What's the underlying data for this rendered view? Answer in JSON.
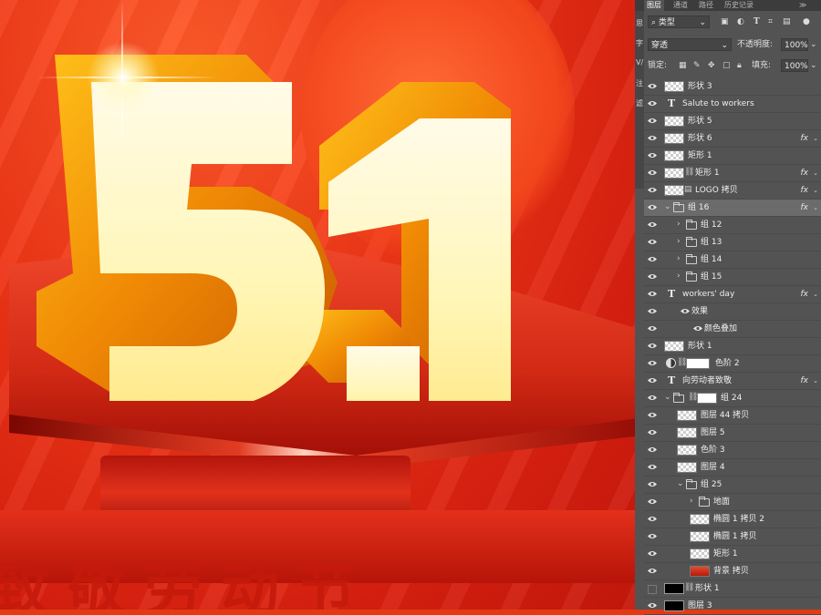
{
  "canvas": {
    "headline": "5.1",
    "floor_text": "致敬劳动节"
  },
  "panel": {
    "tabs": [
      "图层",
      "通道",
      "路径",
      "历史记录"
    ],
    "side_labels": [
      "思",
      "字",
      "V/",
      "注",
      "滤"
    ],
    "filter": {
      "kind_label": "类型",
      "icons": [
        "pixel-filter-icon",
        "adjustment-filter-icon",
        "text-filter-icon",
        "shape-filter-icon",
        "smart-object-filter-icon"
      ]
    },
    "blend_mode": "穿透",
    "opacity_label": "不透明度:",
    "opacity_value": "100%",
    "lock_label": "锁定:",
    "fill_label": "填充:",
    "fill_value": "100%",
    "layers": [
      {
        "name": "形状 3",
        "type": "shape",
        "indent": 0,
        "fx": false
      },
      {
        "name": "Salute to workers",
        "type": "text",
        "indent": 0,
        "fx": false
      },
      {
        "name": "形状 5",
        "type": "shape",
        "indent": 0,
        "fx": false
      },
      {
        "name": "形状 6",
        "type": "shape",
        "indent": 0,
        "fx": true
      },
      {
        "name": "矩形 1",
        "type": "shape",
        "indent": 0,
        "fx": false
      },
      {
        "name": "矩形 1",
        "type": "shape-link",
        "indent": 0,
        "fx": true
      },
      {
        "name": "LOGO 拷贝",
        "type": "smart",
        "indent": 0,
        "fx": true
      },
      {
        "name": "组 16",
        "type": "group-open",
        "indent": 0,
        "fx": true,
        "selected": true
      },
      {
        "name": "组 12",
        "type": "group",
        "indent": 1,
        "fx": false
      },
      {
        "name": "组 13",
        "type": "group",
        "indent": 1,
        "fx": false
      },
      {
        "name": "组 14",
        "type": "group",
        "indent": 1,
        "fx": false
      },
      {
        "name": "组 15",
        "type": "group",
        "indent": 1,
        "fx": false
      },
      {
        "name": "workers' day",
        "type": "text",
        "indent": 0,
        "fx": true
      },
      {
        "name": "效果",
        "type": "effect",
        "indent": 1,
        "fx": false
      },
      {
        "name": "颜色叠加",
        "type": "effect",
        "indent": 2,
        "fx": false
      },
      {
        "name": "形状 1",
        "type": "shape",
        "indent": 0,
        "fx": false
      },
      {
        "name": "色阶 2",
        "type": "adjust",
        "indent": 0,
        "fx": false
      },
      {
        "name": "向劳动者致敬",
        "type": "text",
        "indent": 0,
        "fx": true
      },
      {
        "name": "组 24",
        "type": "group-open-mask",
        "indent": 0,
        "fx": false
      },
      {
        "name": "图层 44 拷贝",
        "type": "shape",
        "indent": 1,
        "fx": false
      },
      {
        "name": "图层 5",
        "type": "shape",
        "indent": 1,
        "fx": false
      },
      {
        "name": "色阶 3",
        "type": "shape",
        "indent": 1,
        "fx": false
      },
      {
        "name": "图层 4",
        "type": "shape",
        "indent": 1,
        "fx": false
      },
      {
        "name": "组 25",
        "type": "group-open",
        "indent": 1,
        "fx": false
      },
      {
        "name": "地面",
        "type": "group",
        "indent": 2,
        "fx": false
      },
      {
        "name": "椭圆 1 拷贝 2",
        "type": "shape",
        "indent": 2,
        "fx": false
      },
      {
        "name": "椭圆 1 拷贝",
        "type": "shape",
        "indent": 2,
        "fx": false
      },
      {
        "name": "矩形 1",
        "type": "shape",
        "indent": 2,
        "fx": false
      },
      {
        "name": "背景 拷贝",
        "type": "red",
        "indent": 2,
        "fx": false
      },
      {
        "name": "形状 1",
        "type": "black-link",
        "indent": 0,
        "fx": false,
        "hidden": true
      },
      {
        "name": "图层 3",
        "type": "black",
        "indent": 0,
        "fx": false
      }
    ]
  }
}
